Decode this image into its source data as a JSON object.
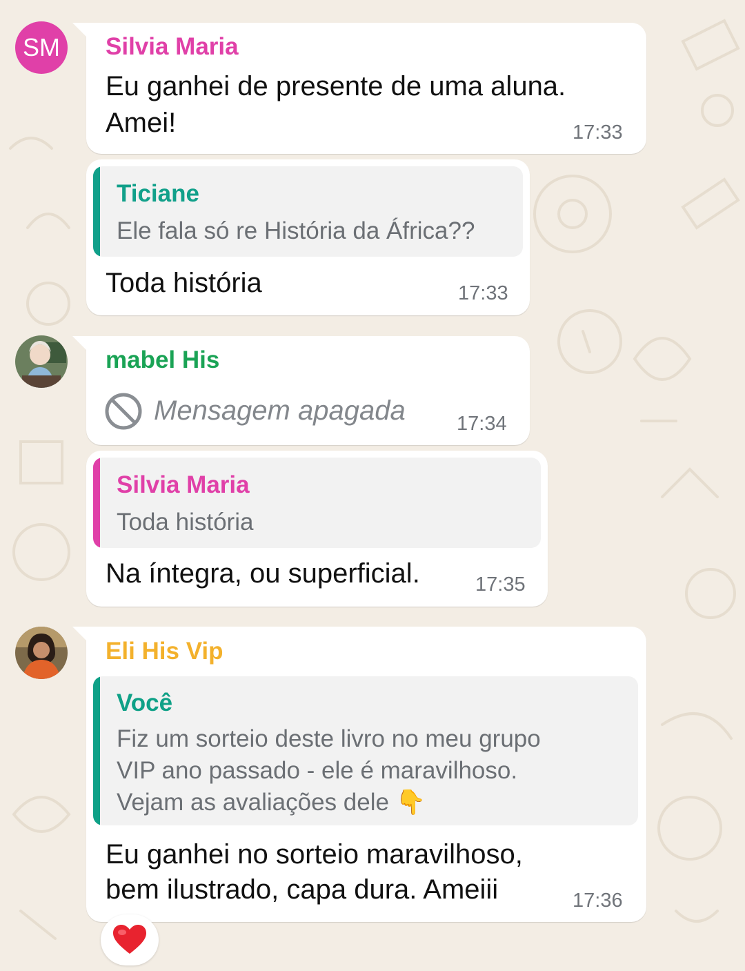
{
  "colors": {
    "wallpaper": "#f3ede4",
    "bubble": "#ffffff",
    "silvia": "#e040a8",
    "ticiane": "#11a08a",
    "mabel": "#1aa355",
    "eli": "#f3b12c",
    "voce": "#0fa187",
    "time": "#6f7379"
  },
  "messages": [
    {
      "sender": "Silvia Maria",
      "avatar_initials": "SM",
      "line1": "Eu ganhei de presente de uma aluna.",
      "line2": "Amei!",
      "time": "17:33"
    },
    {
      "quote_name": "Ticiane",
      "quote_text": "Ele fala só re História da África??",
      "text": "Toda história",
      "time": "17:33"
    },
    {
      "sender": "mabel His",
      "avatar_icon": "profile-photo-icon",
      "deleted_text": "Mensagem apagada",
      "deleted_icon": "blocked-circle-icon",
      "time": "17:34"
    },
    {
      "quote_name": "Silvia Maria",
      "quote_text": "Toda história",
      "text": "Na íntegra, ou superficial.",
      "time": "17:35"
    },
    {
      "sender": "Eli His Vip",
      "avatar_icon": "profile-photo-icon",
      "quote_name": "Você",
      "quote_line1": "Fiz um sorteio deste livro no meu grupo",
      "quote_line2": "VIP ano passado - ele é maravilhoso.",
      "quote_line3": "Vejam as avaliações dele",
      "quote_emoji": "👇",
      "line1": "Eu ganhei no sorteio maravilhoso,",
      "line2": "bem ilustrado, capa dura. Ameiii",
      "time": "17:36",
      "reaction": "❤️"
    }
  ]
}
